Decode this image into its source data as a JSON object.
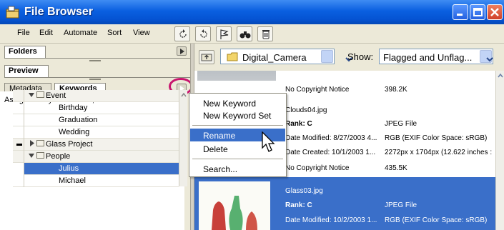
{
  "window": {
    "title": "File Browser"
  },
  "menu": {
    "items": [
      "File",
      "Edit",
      "Automate",
      "Sort",
      "View"
    ]
  },
  "toolbar": {
    "icons": [
      "rotate-ccw-icon",
      "rotate-cw-icon",
      "flag-icon",
      "binoculars-icon",
      "trash-icon"
    ]
  },
  "panels": {
    "folders": "Folders",
    "preview": "Preview"
  },
  "keywords_panel": {
    "tabs": [
      "Metadata",
      "Keywords"
    ],
    "assigned": "Assigned Keywords: Red, Green",
    "tree": [
      {
        "label": "Event",
        "type": "category"
      },
      {
        "label": "Birthday",
        "type": "keyword"
      },
      {
        "label": "Graduation",
        "type": "keyword"
      },
      {
        "label": "Wedding",
        "type": "keyword"
      },
      {
        "label": "Glass Project",
        "type": "category"
      },
      {
        "label": "People",
        "type": "category"
      },
      {
        "label": "Julius",
        "type": "keyword"
      },
      {
        "label": "Michael",
        "type": "keyword"
      }
    ]
  },
  "location": {
    "folder": "Digital_Camera",
    "show_label": "Show:",
    "show_value": "Flagged and Unflag..."
  },
  "files": {
    "top": {
      "copyright": "No Copyright Notice",
      "size": "398.2K"
    },
    "clouds": {
      "name": "Clouds04.jpg",
      "rank": "Rank: C",
      "type": "JPEG File",
      "modified": "Date Modified: 8/27/2003  4...",
      "color_space": "RGB (EXIF Color Space: sRGB)",
      "created": "Date Created: 10/1/2003  1...",
      "dimensions": "2272px x 1704px (12.622 inches :",
      "copyright": "No Copyright Notice",
      "size": "435.5K"
    },
    "glass": {
      "name": "Glass03.jpg",
      "rank": "Rank: C",
      "type": "JPEG File",
      "modified": "Date Modified: 10/2/2003  1...",
      "color_space": "RGB (EXIF Color Space: sRGB)"
    }
  },
  "context_menu": {
    "items": [
      "New Keyword",
      "New Keyword Set",
      "Rename",
      "Delete",
      "Search..."
    ],
    "highlighted": "Rename"
  },
  "colors": {
    "title_bar": "#0a5fe0",
    "selection": "#3a6fc9",
    "highlight_ring": "#c8166e",
    "chrome": "#ece9d8"
  }
}
